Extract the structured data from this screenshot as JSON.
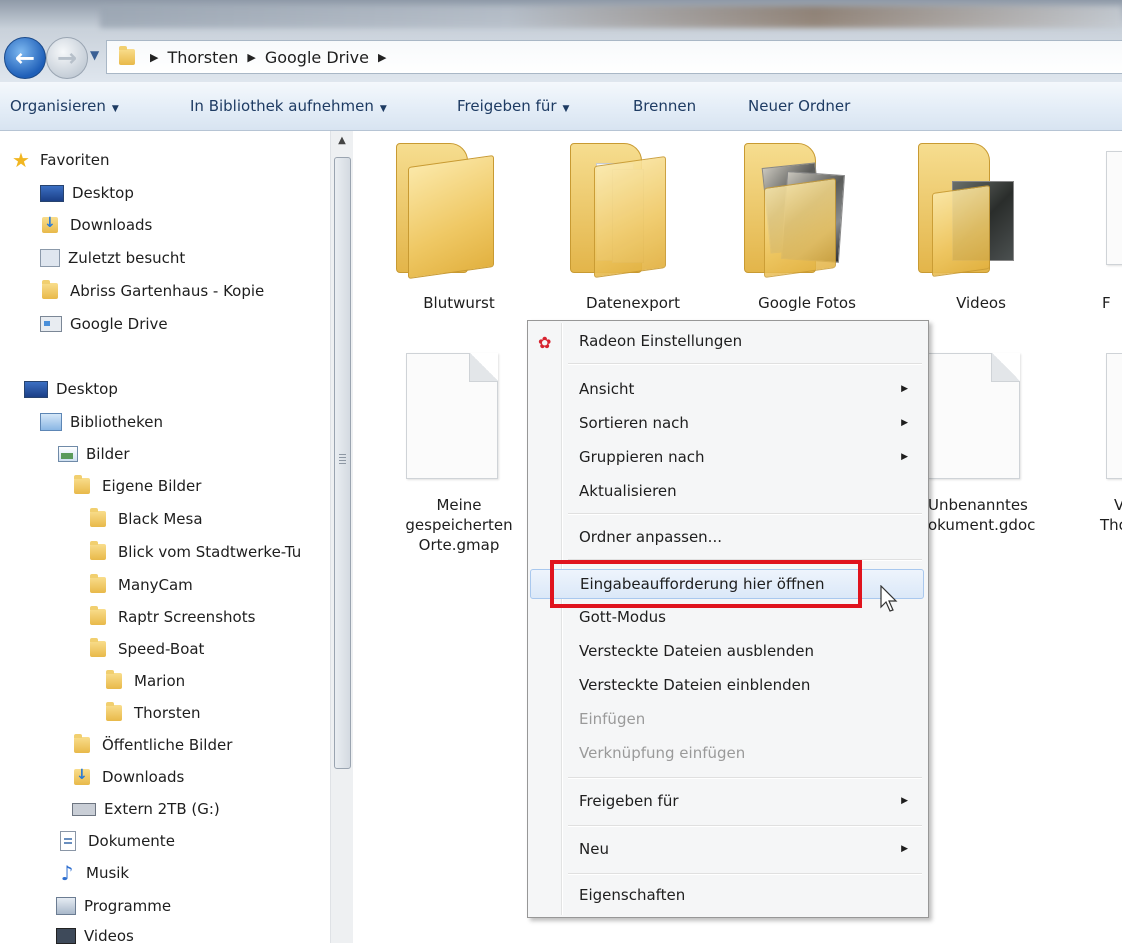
{
  "breadcrumb": {
    "items": [
      "Thorsten",
      "Google Drive"
    ]
  },
  "toolbar": {
    "organize": "Organisieren",
    "library": "In Bibliothek aufnehmen",
    "share": "Freigeben für",
    "burn": "Brennen",
    "new_folder": "Neuer Ordner"
  },
  "sidebar": {
    "favorites": {
      "label": "Favoriten"
    },
    "items": [
      {
        "label": "Desktop"
      },
      {
        "label": "Downloads"
      },
      {
        "label": "Zuletzt besucht"
      },
      {
        "label": "Abriss Gartenhaus - Kopie"
      },
      {
        "label": "Google Drive"
      }
    ],
    "tree": [
      {
        "label": "Desktop"
      },
      {
        "label": "Bibliotheken"
      },
      {
        "label": "Bilder"
      },
      {
        "label": "Eigene Bilder"
      },
      {
        "label": "Black Mesa"
      },
      {
        "label": "Blick vom Stadtwerke-Tu"
      },
      {
        "label": "ManyCam"
      },
      {
        "label": "Raptr Screenshots"
      },
      {
        "label": "Speed-Boat"
      },
      {
        "label": "Marion"
      },
      {
        "label": "Thorsten"
      },
      {
        "label": "Öffentliche Bilder"
      },
      {
        "label": "Downloads"
      },
      {
        "label": "Extern 2TB (G:)"
      },
      {
        "label": "Dokumente"
      },
      {
        "label": "Musik"
      },
      {
        "label": "Programme"
      },
      {
        "label": "Videos"
      }
    ]
  },
  "files": {
    "folders": [
      {
        "label": "Blutwurst"
      },
      {
        "label": "Datenexport"
      },
      {
        "label": "Google Fotos"
      },
      {
        "label": "Videos"
      },
      {
        "label": "F"
      }
    ],
    "docs": [
      {
        "line1": "Meine",
        "line2": "gespeicherten",
        "line3": "Orte.gmap"
      },
      {
        "line1": "Unbenanntes",
        "line2": "okument.gdoc"
      },
      {
        "line1": "V",
        "line2": "Tho"
      }
    ]
  },
  "context_menu": {
    "radeon": "Radeon Einstellungen",
    "view": "Ansicht",
    "sort": "Sortieren nach",
    "group": "Gruppieren nach",
    "refresh": "Aktualisieren",
    "customize": "Ordner anpassen...",
    "open_cmd": "Eingabeaufforderung hier öffnen",
    "god_mode": "Gott-Modus",
    "hide_hidden": "Versteckte Dateien ausblenden",
    "show_hidden": "Versteckte Dateien einblenden",
    "paste": "Einfügen",
    "paste_link": "Verknüpfung einfügen",
    "share": "Freigeben für",
    "new": "Neu",
    "properties": "Eigenschaften"
  },
  "colors": {
    "highlight": "#e0131d",
    "accent": "#1f5fb8"
  }
}
